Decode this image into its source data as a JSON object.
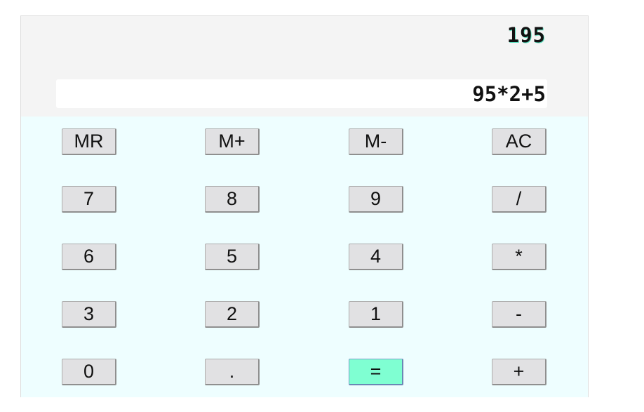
{
  "display": {
    "result": "195",
    "expression": "95*2+5"
  },
  "keys": {
    "mr": "MR",
    "m_plus": "M+",
    "m_minus": "M-",
    "ac": "AC",
    "seven": "7",
    "eight": "8",
    "nine": "9",
    "divide": "/",
    "six": "6",
    "five": "5",
    "four": "4",
    "multiply": "*",
    "three": "3",
    "two": "2",
    "one": "1",
    "minus": "-",
    "zero": "0",
    "dot": ".",
    "equals": "=",
    "plus": "+"
  },
  "colors": {
    "display_background": "#f4f4f4",
    "keypad_background": "#eefeff",
    "key_background": "#e1e1e3",
    "equals_background": "#7fffd2"
  }
}
